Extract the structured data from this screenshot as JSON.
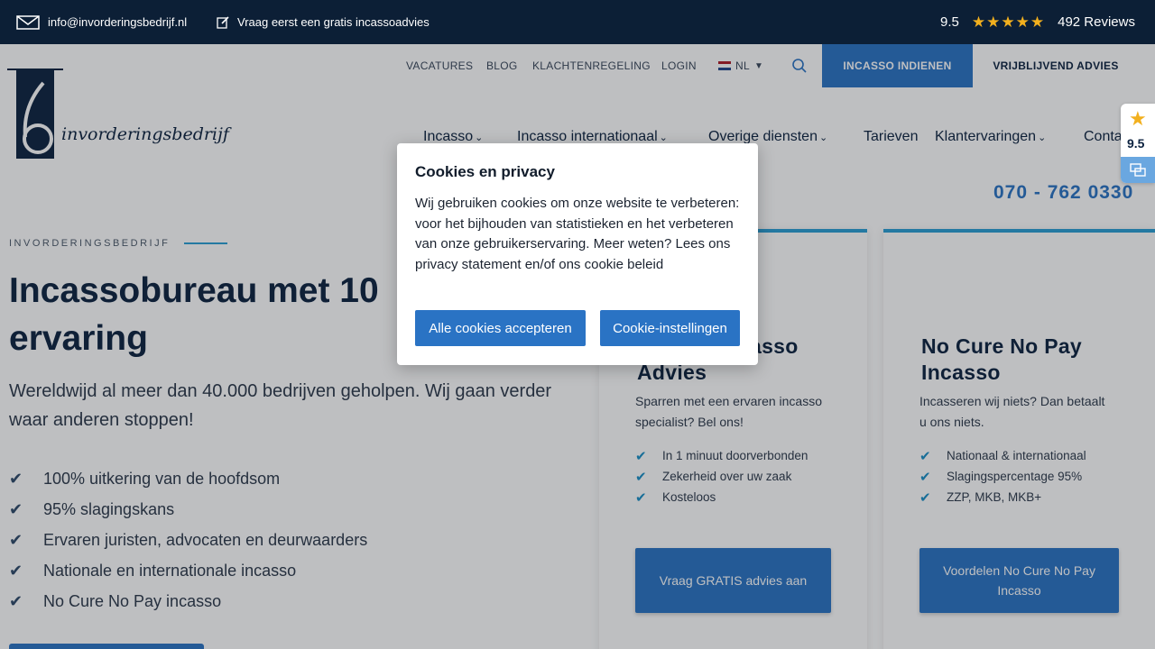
{
  "topbar": {
    "email": "info@invorderingsbedrijf.nl",
    "advice": "Vraag eerst een gratis incassoadvies",
    "score": "9.5",
    "stars": "★★★★★",
    "reviews": "492 Reviews"
  },
  "subnav": {
    "links": [
      "VACATURES",
      "BLOG",
      "KLACHTENREGELING",
      "LOGIN"
    ],
    "language": "NL",
    "incasso_button": "INCASSO INDIENEN",
    "advies_button": "VRIJBLIJVEND ADVIES"
  },
  "logo": {
    "digit": "6",
    "wordmark": "invorderingsbedrijf"
  },
  "mainnav": {
    "items": [
      "Incasso",
      "Incasso internationaal",
      "Overige diensten",
      "Tarieven",
      "Klantervaringen",
      "Conta"
    ]
  },
  "phone": "070 - 762 0330",
  "badge": {
    "score": "9.5"
  },
  "hero": {
    "eyebrow": "INVORDERINGSBEDRIJF",
    "title_line1": "Incassobureau met 10",
    "title_line2": "ervaring",
    "subtitle": "Wereldwijd al meer dan 40.000 bedrijven geholpen. Wij gaan verder waar anderen stoppen!",
    "checks": [
      "100% uitkering van de hoofdsom",
      "95% slagingskans",
      "Ervaren juristen, advocaten en deurwaarders",
      "Nationale en internationale incasso",
      "No Cure No Pay incasso"
    ]
  },
  "cards": [
    {
      "title_line1": "asso",
      "title_line2": "Advies",
      "desc": "Sparren met een ervaren incasso specialist? Bel ons!",
      "items": [
        "In 1 minuut doorverbonden",
        "Zekerheid over uw zaak",
        "Kosteloos"
      ],
      "button": "Vraag GRATIS advies aan"
    },
    {
      "title_line1": "No Cure No Pay",
      "title_line2": "Incasso",
      "desc": "Incasseren wij niets? Dan betaalt u ons niets.",
      "items": [
        "Nationaal & internationaal",
        "Slagingspercentage 95%",
        "ZZP, MKB, MKB+"
      ],
      "button": "Voordelen No Cure No Pay Incasso"
    }
  ],
  "cookie": {
    "title": "Cookies en privacy",
    "text": "Wij gebruiken cookies om onze website te verbeteren: voor het bijhouden van statistieken en het verbeteren van onze gebruikerservaring. Meer weten? Lees ons privacy statement en/of ons cookie beleid",
    "accept": "Alle cookies accepteren",
    "settings": "Cookie-instellingen"
  },
  "colors": {
    "navy": "#0c1f36",
    "brand_blue": "#2a73c4",
    "accent_teal": "#2a9ed4",
    "star": "#f2b01e"
  },
  "icons": [
    "envelope-icon",
    "edit-icon",
    "star-icon",
    "search-icon",
    "chevron-down-icon",
    "check-icon",
    "flag-nl-icon"
  ]
}
